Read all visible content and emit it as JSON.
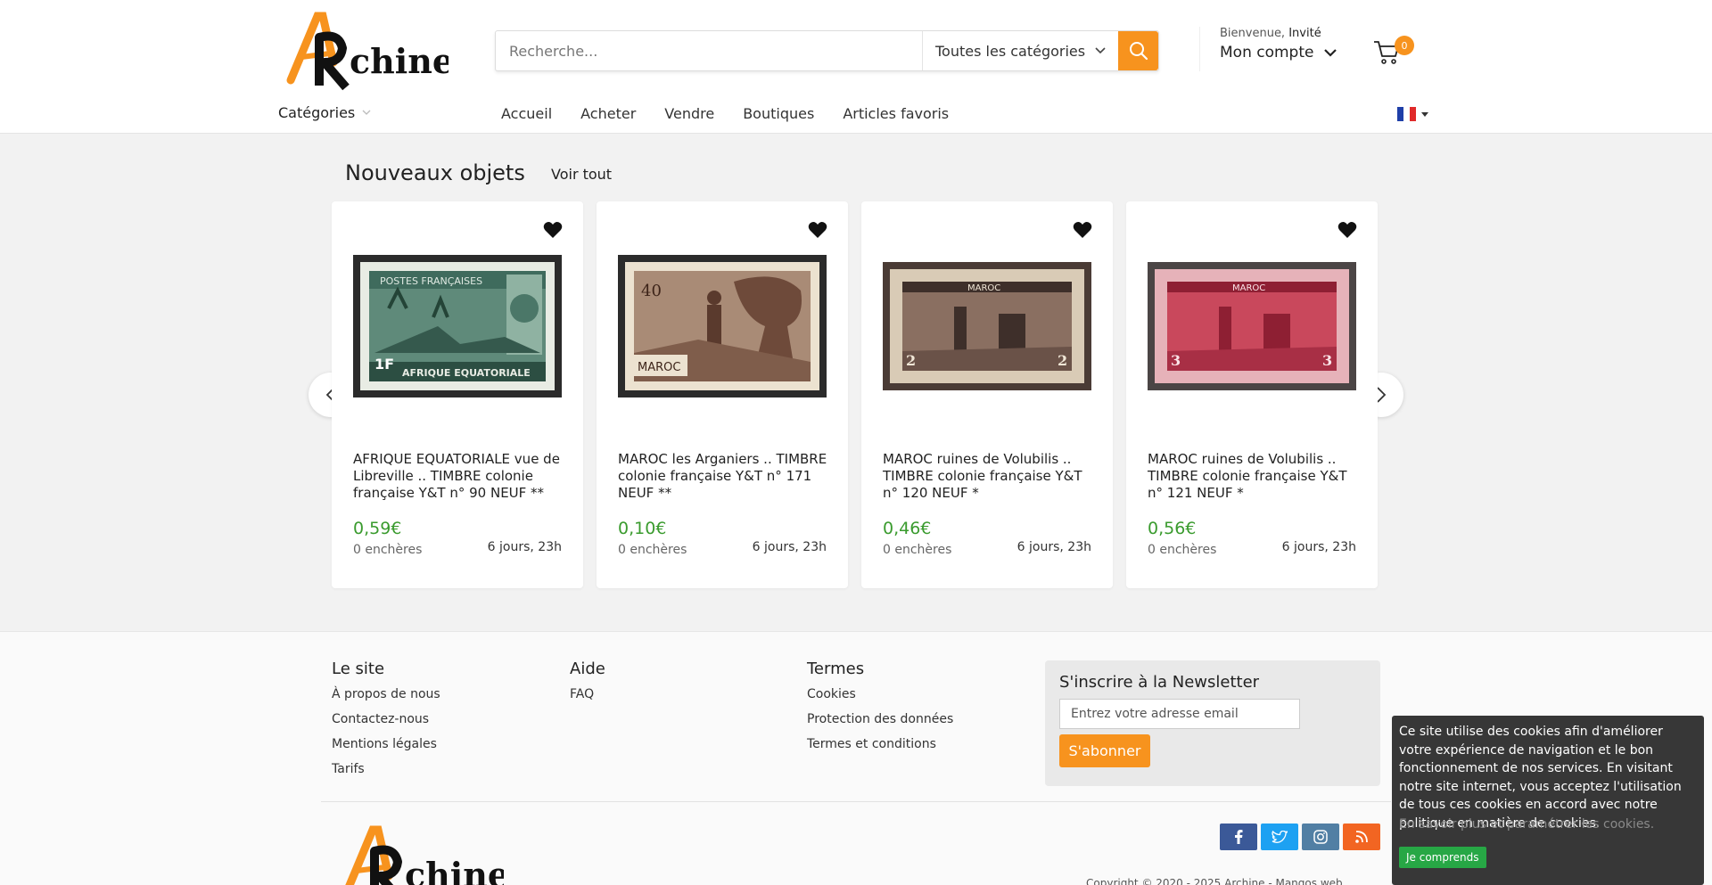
{
  "header": {
    "logo_text": "ARchine",
    "search_placeholder": "Recherche...",
    "category_select": "Toutes les catégories",
    "welcome_prefix": "Bienvenue,",
    "welcome_user": "Invité",
    "account_label": "Mon compte",
    "cart_count": "0"
  },
  "nav": {
    "categories_label": "Catégories",
    "links": [
      "Accueil",
      "Acheter",
      "Vendre",
      "Boutiques",
      "Articles favoris"
    ]
  },
  "section": {
    "title": "Nouveaux objets",
    "see_all": "Voir tout"
  },
  "items": [
    {
      "title": "AFRIQUE EQUATORIALE vue de Libreville .. TIMBRE colonie française Y&T n° 90 NEUF **",
      "price": "0,59€",
      "bids": "0 enchères",
      "time": "6 jours, 23h",
      "stamp_text": "POSTES FRANÇAISES",
      "stamp_bottom": "AFRIQUE EQUATORIALE",
      "stamp_value": "1F"
    },
    {
      "title": "MAROC les Arganiers .. TIMBRE colonie française Y&T n° 171 NEUF **",
      "price": "0,10€",
      "bids": "0 enchères",
      "time": "6 jours, 23h",
      "stamp_text": "MAROC",
      "stamp_value": "40"
    },
    {
      "title": "MAROC ruines de Volubilis .. TIMBRE colonie française Y&T n° 120 NEUF *",
      "price": "0,46€",
      "bids": "0 enchères",
      "time": "6 jours, 23h",
      "stamp_text": "MAROC",
      "stamp_value": "2"
    },
    {
      "title": "MAROC ruines de Volubilis .. TIMBRE colonie française Y&T n° 121 NEUF *",
      "price": "0,56€",
      "bids": "0 enchères",
      "time": "6 jours, 23h",
      "stamp_text": "MAROC",
      "stamp_value": "3"
    }
  ],
  "footer": {
    "site": {
      "title": "Le site",
      "links": [
        "À propos de nous",
        "Contactez-nous",
        "Mentions légales",
        "Tarifs"
      ]
    },
    "help": {
      "title": "Aide",
      "links": [
        "FAQ"
      ]
    },
    "terms": {
      "title": "Termes",
      "links": [
        "Cookies",
        "Protection des données",
        "Termes et conditions"
      ]
    },
    "newsletter": {
      "title": "S'inscrire à la Newsletter",
      "placeholder": "Entrez votre adresse email",
      "button": "S'abonner"
    },
    "copyright": "Copyright © 2020 - 2025 Archine - Mangos web."
  },
  "cookie": {
    "text": "Ce site utilise des cookies afin d'améliorer votre expérience de navigation et le bon fonctionnement de nos services. En visitant notre site internet, vous acceptez l'utilisation de tous ces cookies en accord avec notre politique en matière de cookies.",
    "more": "En savoir plus et paramétrer les cookies.",
    "button": "Je comprends"
  },
  "colors": {
    "accent": "#f7931e",
    "price": "#3a9b2e",
    "facebook": "#3b5998",
    "twitter": "#1da1f2",
    "instagram": "#517fa4",
    "rss": "#f26522",
    "cookie_ok": "#27a745"
  },
  "icons": [
    "search-icon",
    "chevron-down-icon",
    "cart-icon",
    "heart-icon",
    "arrow-left-icon",
    "arrow-right-icon",
    "facebook-icon",
    "twitter-icon",
    "instagram-icon",
    "rss-icon",
    "french-flag-icon"
  ]
}
